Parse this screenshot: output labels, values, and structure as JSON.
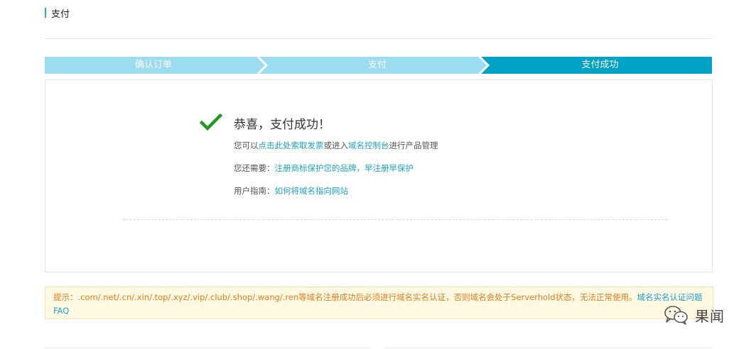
{
  "header": {
    "title": "支付"
  },
  "steps": [
    {
      "label": "确认订单",
      "state": "done"
    },
    {
      "label": "支付",
      "state": "done"
    },
    {
      "label": "支付成功",
      "state": "active"
    }
  ],
  "colors": {
    "step_done": "#9bdcf1",
    "step_active": "#00a3c6",
    "link": "#1da3cf",
    "success": "#1f9a1f",
    "notice_text": "#e27e1b",
    "notice_bg": "#fff8e3"
  },
  "success": {
    "icon": "check-icon",
    "title": "恭喜，支付成功！",
    "line1": {
      "prefix": "您可以",
      "link1": "点击此处索取发票",
      "middle": "或进入",
      "link2": "域名控制台",
      "suffix": "进行产品管理"
    },
    "line2": {
      "prefix": "您还需要：",
      "link": "注册商标保护您的品牌，早注册早保护"
    },
    "line3": {
      "prefix": "用户指南：",
      "link": "如何将域名指向网站"
    }
  },
  "notice": {
    "text": "提示：.com/.net/.cn/.xin/.top/.xyz/.vip/.club/.shop/.wang/.ren等域名注册成功后必须进行域名实名认证，否则域名会处于Serverhold状态，无法正常使用。",
    "link": "域名实名认证问题FAQ"
  },
  "watermark": {
    "icon": "wechat-icon",
    "text": "果闻"
  }
}
